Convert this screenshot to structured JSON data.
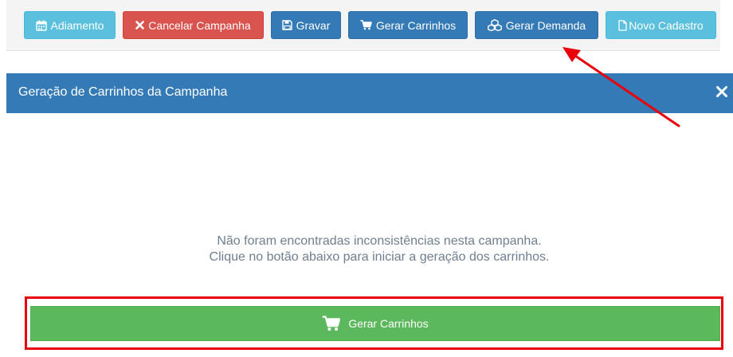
{
  "toolbar": {
    "buttons": [
      {
        "label": "Adiamento",
        "icon": "calendar-icon"
      },
      {
        "label": "Cancelar Campanha",
        "icon": "close-icon"
      },
      {
        "label": "Gravar",
        "icon": "save-icon"
      },
      {
        "label": "Gerar Carrinhos",
        "icon": "cart-icon"
      },
      {
        "label": "Gerar Demanda",
        "icon": "cubes-icon"
      },
      {
        "label": "Novo Cadastro",
        "icon": "file-icon"
      }
    ]
  },
  "modal": {
    "title": "Geração de Carrinhos da Campanha",
    "close_icon": "close-icon",
    "message_line1": "Não foram encontradas inconsistências nesta campanha.",
    "message_line2": "Clique no botão abaixo para iniciar a geração dos carrinhos.",
    "primary_button_label": "Gerar Carrinhos",
    "primary_button_icon": "cart-icon"
  },
  "colors": {
    "info": "#5bc0de",
    "danger": "#d9534f",
    "primary": "#337ab7",
    "success": "#5cb85c",
    "annotation": "#e8000b"
  }
}
